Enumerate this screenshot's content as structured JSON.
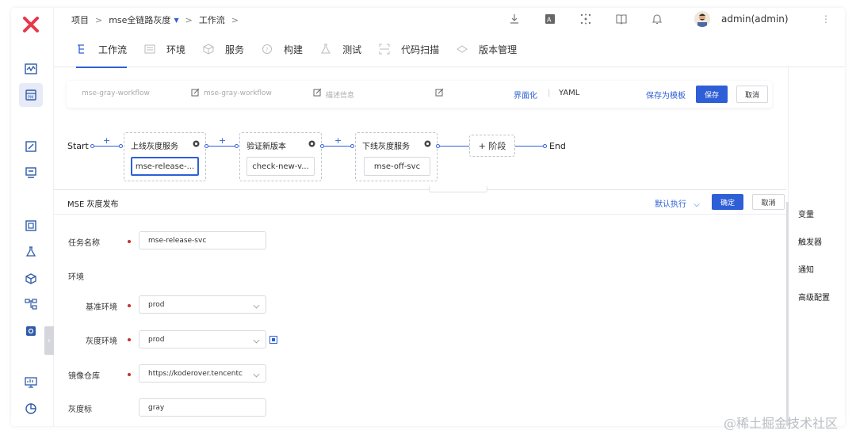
{
  "breadcrumb": {
    "root": "项目",
    "project": "mse全链路灰度",
    "page": "工作流"
  },
  "topbar": {
    "icons": [
      "download-icon",
      "translate-icon",
      "network-icon",
      "book-icon",
      "bell-icon"
    ],
    "username": "admin(admin)"
  },
  "tabs": [
    {
      "label": "工作流",
      "icon": "workflow-icon",
      "active": true
    },
    {
      "label": "环境",
      "icon": "environment-icon"
    },
    {
      "label": "服务",
      "icon": "service-icon"
    },
    {
      "label": "构建",
      "icon": "build-icon"
    },
    {
      "label": "测试",
      "icon": "test-icon"
    },
    {
      "label": "代码扫描",
      "icon": "scan-icon"
    },
    {
      "label": "版本管理",
      "icon": "version-icon"
    }
  ],
  "workflow_header": {
    "name": "mse-gray-workflow",
    "display_name": "mse-gray-workflow",
    "description_placeholder": "描述信息",
    "ui_mode": "界面化",
    "yaml_mode": "YAML",
    "save_template": "保存为模板",
    "save": "保存",
    "cancel": "取消"
  },
  "pipeline": {
    "start": "Start",
    "end": "End",
    "add_stage": "+ 阶段",
    "stages": [
      {
        "title": "上线灰度服务",
        "job": "mse-release-..."
      },
      {
        "title": "验证新版本",
        "job": "check-new-v..."
      },
      {
        "title": "下线灰度服务",
        "job": "mse-off-svc"
      }
    ]
  },
  "right_panel": {
    "items": [
      "变量",
      "触发器",
      "通知",
      "高级配置"
    ]
  },
  "drawer": {
    "title": "MSE 灰度发布",
    "exec_mode": "默认执行",
    "confirm": "确定",
    "cancel": "取消",
    "fields": {
      "task_name_label": "任务名称",
      "task_name_value": "mse-release-svc",
      "env_section": "环境",
      "base_env_label": "基准环境",
      "base_env_value": "prod",
      "gray_env_label": "灰度环境",
      "gray_env_value": "prod",
      "registry_label": "镜像仓库",
      "registry_value": "https://koderover.tencentc",
      "gray_tag_label": "灰度标",
      "gray_tag_value": "gray"
    }
  },
  "watermark": "@稀土掘金技术社区",
  "colors": {
    "accent": "#2f5fd6",
    "brand_logo": "#e8374a",
    "required": "#c0352b"
  }
}
